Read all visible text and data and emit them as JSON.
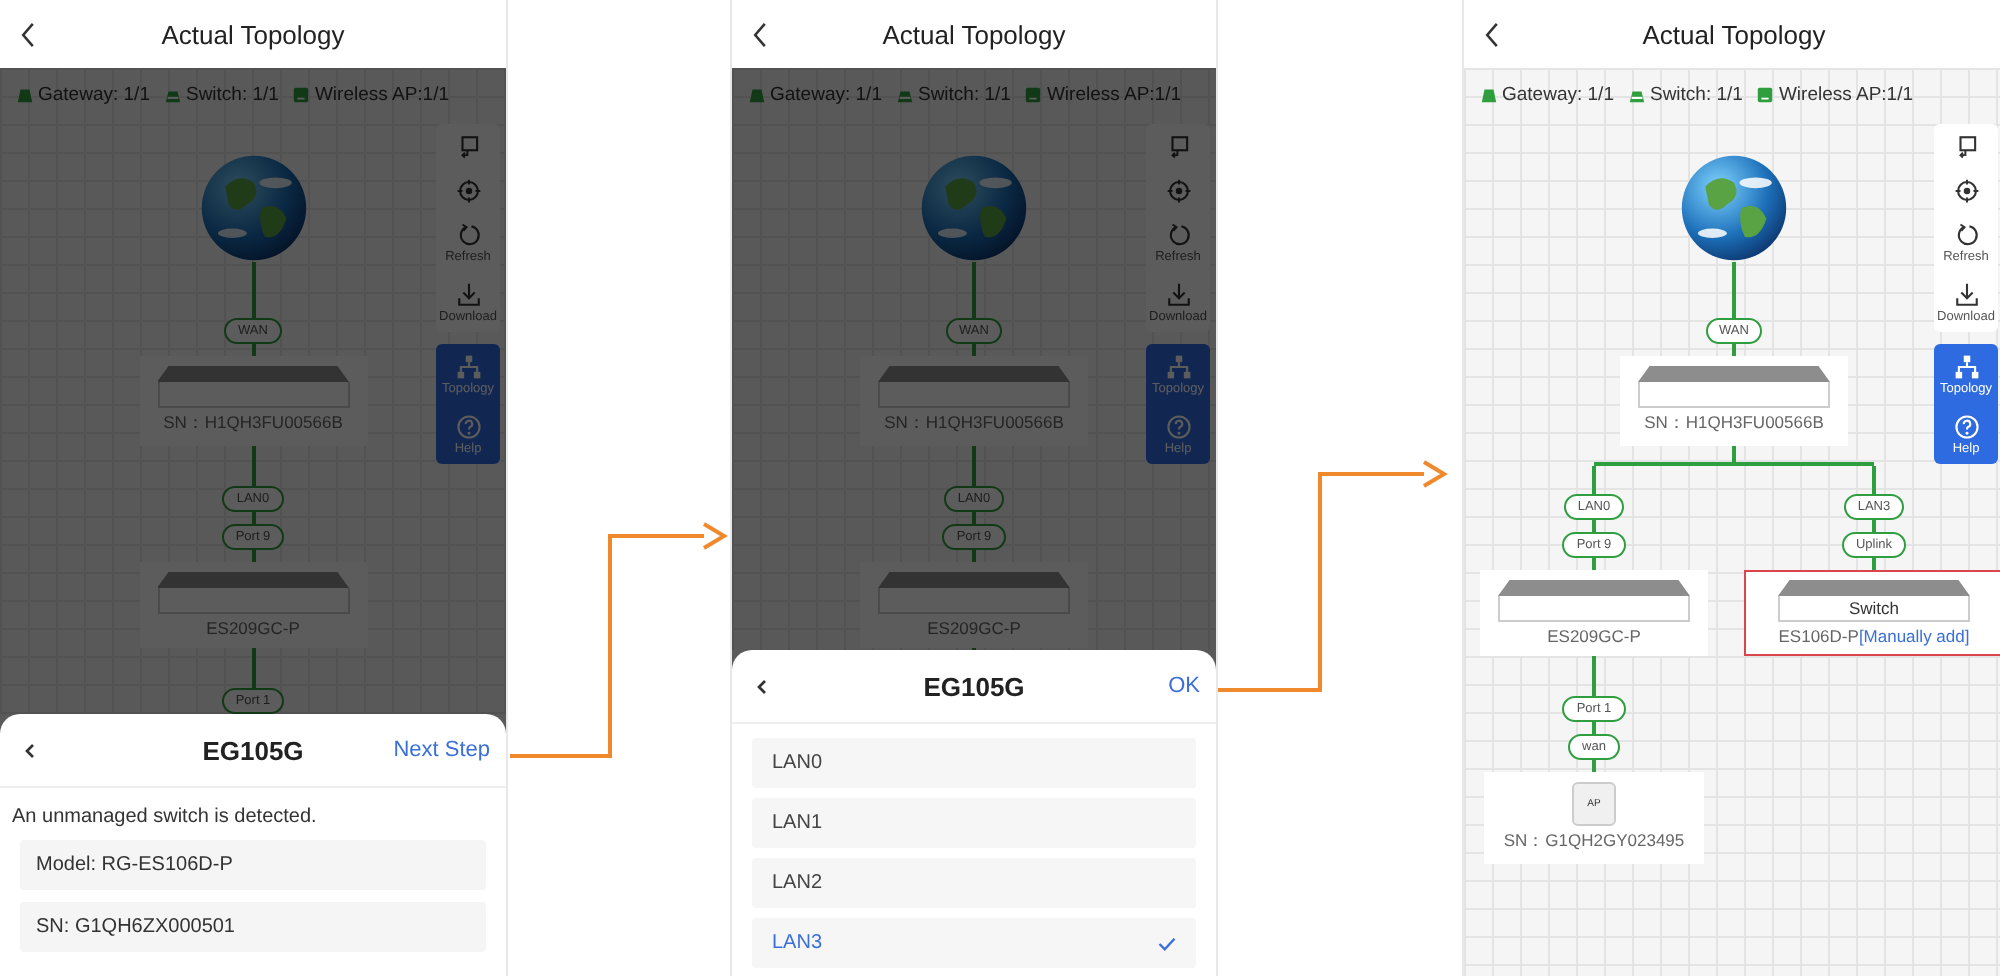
{
  "screens": [
    {
      "header": {
        "title": "Actual Topology"
      },
      "dimmed": true,
      "legend": [
        {
          "kind": "gateway",
          "label": "Gateway: 1/1"
        },
        {
          "kind": "switch",
          "label": "Switch: 1/1"
        },
        {
          "kind": "ap",
          "label": "Wireless AP:1/1"
        }
      ],
      "toolbar": {
        "tools": [
          {
            "kind": "fit"
          },
          {
            "kind": "locate"
          },
          {
            "kind": "refresh",
            "label": "Refresh"
          },
          {
            "kind": "download",
            "label": "Download"
          }
        ],
        "modes": [
          {
            "kind": "topology",
            "label": "Topology"
          },
          {
            "kind": "help",
            "label": "Help"
          }
        ]
      },
      "topology": {
        "kind": "internet",
        "children": [
          {
            "kind": "gateway",
            "uplink_tags": [
              "WAN"
            ],
            "caption": "SN：H1QH3FU00566B",
            "highlighted": false,
            "children": [
              {
                "kind": "switch",
                "uplink_tags": [
                  "LAN0",
                  "Port 9"
                ],
                "caption": "ES209GC-P",
                "highlighted": false,
                "children": [
                  {
                    "kind": "truncated",
                    "uplink_tags": [
                      "Port 1"
                    ]
                  }
                ]
              }
            ]
          }
        ]
      },
      "sheet": {
        "kind": "notice",
        "title": "EG105G",
        "action": "Next Step",
        "message": "An unmanaged switch is detected.",
        "fields": [
          "Model: RG-ES106D-P",
          "SN: G1QH6ZX000501"
        ]
      }
    },
    {
      "header": {
        "title": "Actual Topology"
      },
      "dimmed": true,
      "legend": [
        {
          "kind": "gateway",
          "label": "Gateway: 1/1"
        },
        {
          "kind": "switch",
          "label": "Switch: 1/1"
        },
        {
          "kind": "ap",
          "label": "Wireless AP:1/1"
        }
      ],
      "toolbar": {
        "tools": [
          {
            "kind": "fit"
          },
          {
            "kind": "locate"
          },
          {
            "kind": "refresh",
            "label": "Refresh"
          },
          {
            "kind": "download",
            "label": "Download"
          }
        ],
        "modes": [
          {
            "kind": "topology",
            "label": "Topology"
          },
          {
            "kind": "help",
            "label": "Help"
          }
        ]
      },
      "topology": {
        "kind": "internet",
        "children": [
          {
            "kind": "gateway",
            "uplink_tags": [
              "WAN"
            ],
            "caption": "SN：H1QH3FU00566B",
            "highlighted": false,
            "children": [
              {
                "kind": "switch",
                "uplink_tags": [
                  "LAN0",
                  "Port 9"
                ],
                "caption": "ES209GC-P",
                "highlighted": false,
                "children": [
                  {
                    "kind": "truncated"
                  }
                ]
              }
            ]
          }
        ]
      },
      "sheet": {
        "kind": "port_picker",
        "title": "EG105G",
        "action": "OK",
        "options": [
          {
            "label": "LAN0",
            "selected": false
          },
          {
            "label": "LAN1",
            "selected": false
          },
          {
            "label": "LAN2",
            "selected": false
          },
          {
            "label": "LAN3",
            "selected": true
          }
        ]
      }
    },
    {
      "header": {
        "title": "Actual Topology"
      },
      "dimmed": false,
      "legend": [
        {
          "kind": "gateway",
          "label": "Gateway: 1/1"
        },
        {
          "kind": "switch",
          "label": "Switch: 1/1"
        },
        {
          "kind": "ap",
          "label": "Wireless AP:1/1"
        }
      ],
      "toolbar": {
        "tools": [
          {
            "kind": "fit"
          },
          {
            "kind": "locate"
          },
          {
            "kind": "refresh",
            "label": "Refresh"
          },
          {
            "kind": "download",
            "label": "Download"
          }
        ],
        "modes": [
          {
            "kind": "topology",
            "label": "Topology"
          },
          {
            "kind": "help",
            "label": "Help"
          }
        ]
      },
      "topology": {
        "kind": "internet",
        "children": [
          {
            "kind": "gateway",
            "uplink_tags": [
              "WAN"
            ],
            "caption": "SN：H1QH3FU00566B",
            "highlighted": false,
            "children": [
              {
                "kind": "switch",
                "uplink_tags": [
                  "LAN0",
                  "Port 9"
                ],
                "caption": "ES209GC-P",
                "highlighted": false,
                "children": [
                  {
                    "kind": "ap",
                    "uplink_tags": [
                      "Port 1",
                      "wan"
                    ],
                    "device_label": "AP",
                    "caption": "SN：G1QH2GY023495",
                    "highlighted": false
                  }
                ]
              },
              {
                "kind": "switch",
                "uplink_tags": [
                  "LAN3",
                  "Uplink"
                ],
                "device_label": "Switch",
                "caption": "ES106D-P",
                "note": "[Manually add]",
                "highlighted": true
              }
            ]
          }
        ]
      }
    }
  ]
}
